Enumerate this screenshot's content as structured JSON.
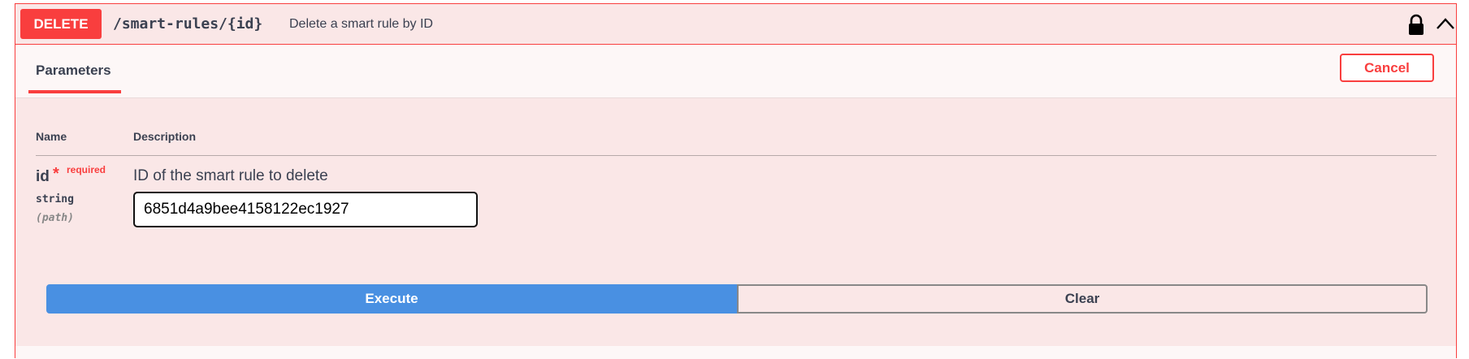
{
  "summary": {
    "method": "DELETE",
    "path": "/smart-rules/{id}",
    "description": "Delete a smart rule by ID",
    "icons": {
      "lock": "lock-icon",
      "collapse": "chevron-up-icon"
    }
  },
  "tabs": {
    "parameters_label": "Parameters",
    "cancel_label": "Cancel"
  },
  "table": {
    "headers": {
      "name": "Name",
      "description": "Description"
    },
    "rows": [
      {
        "name": "id",
        "required_mark": "*",
        "required_label": "required",
        "type": "string",
        "in": "(path)",
        "description": "ID of the smart rule to delete",
        "value": "6851d4a9bee4158122ec1927"
      }
    ]
  },
  "actions": {
    "execute_label": "Execute",
    "clear_label": "Clear"
  },
  "colors": {
    "method_delete": "#f93e3e",
    "execute": "#4990e2",
    "panel_bg": "#fae7e7"
  }
}
